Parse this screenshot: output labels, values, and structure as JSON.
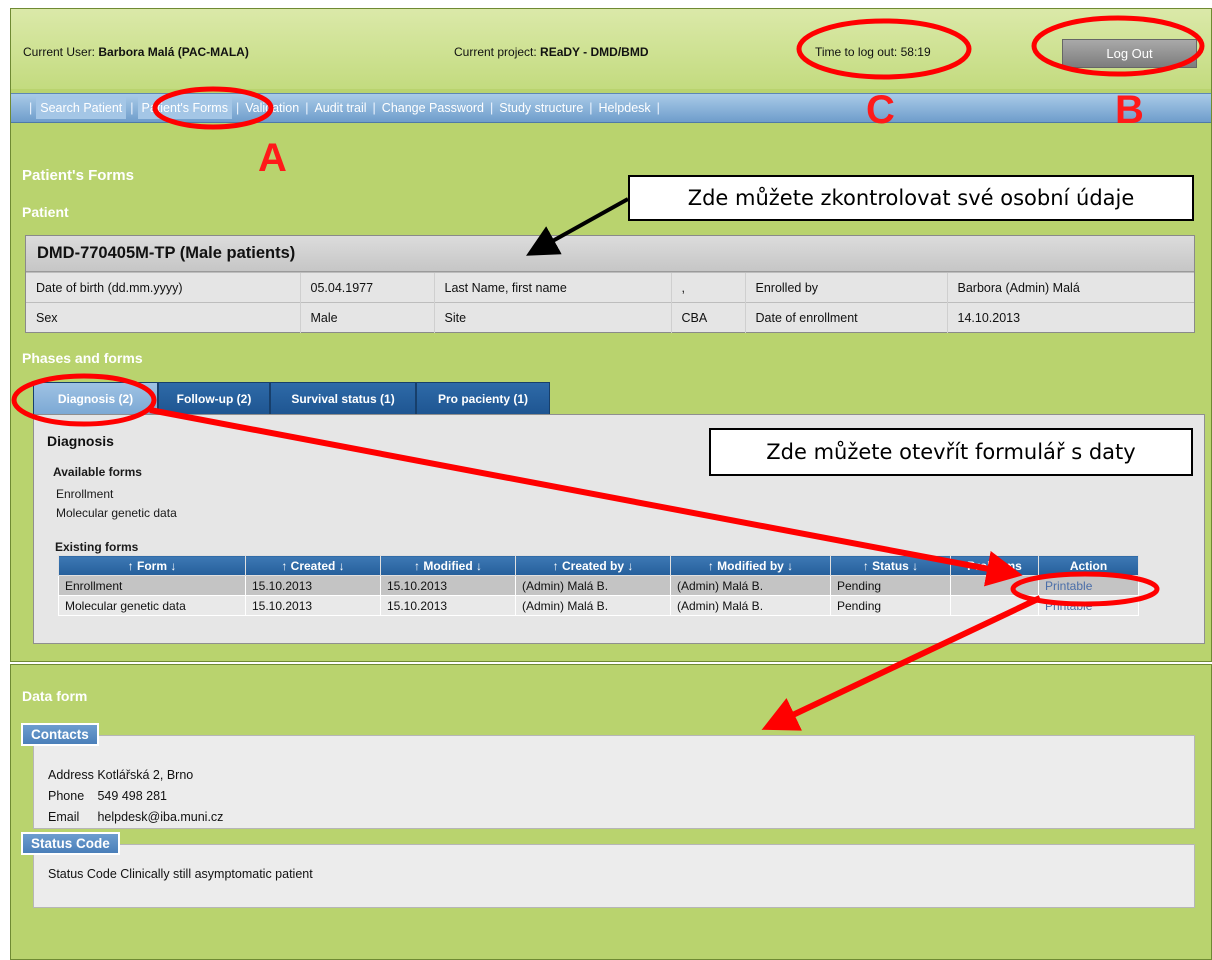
{
  "header": {
    "user_label": "Current User:",
    "user_name": "Barbora Malá (PAC-MALA)",
    "project_label": "Current project:",
    "project_name": "REaDY - DMD/BMD",
    "timer_label": "Time to log out:",
    "timer_value": "58:19",
    "logout_label": "Log Out"
  },
  "nav": {
    "items": [
      {
        "label": "Search Patient"
      },
      {
        "label": "Patient's Forms"
      },
      {
        "label": "Validation"
      },
      {
        "label": "Audit trail"
      },
      {
        "label": "Change Password"
      },
      {
        "label": "Study structure"
      },
      {
        "label": "Helpdesk"
      }
    ]
  },
  "page": {
    "title": "Patient's Forms",
    "patient_heading": "Patient",
    "phases_heading": "Phases and forms"
  },
  "patient": {
    "id": "DMD-770405M-TP (Male patients)",
    "rows": [
      [
        "Date of birth (dd.mm.yyyy)",
        "05.04.1977",
        "Last Name, first name",
        ",",
        "Enrolled by",
        "Barbora (Admin) Malá"
      ],
      [
        "Sex",
        "Male",
        "Site",
        "CBA",
        "Date of enrollment",
        "14.10.2013"
      ]
    ]
  },
  "tabs": [
    {
      "label": "Diagnosis (2)"
    },
    {
      "label": "Follow-up (2)"
    },
    {
      "label": "Survival status (1)"
    },
    {
      "label": "Pro pacienty (1)"
    }
  ],
  "diagnosis": {
    "title": "Diagnosis",
    "available_heading": "Available forms",
    "available": [
      "Enrollment",
      "Molecular genetic data"
    ],
    "existing_heading": "Existing forms",
    "columns": [
      "Form",
      "Created",
      "Modified",
      "Created by",
      "Modified by",
      "Status",
      "Problems",
      "Action"
    ],
    "rows": [
      [
        "Enrollment",
        "15.10.2013",
        "15.10.2013",
        "(Admin) Malá B.",
        "(Admin) Malá B.",
        "Pending",
        "",
        "Printable"
      ],
      [
        "Molecular genetic data",
        "15.10.2013",
        "15.10.2013",
        "(Admin) Malá B.",
        "(Admin) Malá B.",
        "Pending",
        "",
        "Printable"
      ]
    ]
  },
  "data_form": {
    "title": "Data form",
    "contacts_legend": "Contacts",
    "contacts": [
      {
        "key": "Address",
        "value": "Kotlářská 2, Brno"
      },
      {
        "key": "Phone",
        "value": "549 498 281"
      },
      {
        "key": "Email",
        "value": "helpdesk@iba.muni.cz"
      }
    ],
    "status_legend": "Status Code",
    "status_line": "Status Code Clinically still asymptomatic patient"
  },
  "annotations": {
    "callout_personal": "Zde můžete zkontrolovat své osobní údaje",
    "callout_form": "Zde můžete otevřít formulář s daty",
    "letter_a": "A",
    "letter_b": "B",
    "letter_c": "C",
    "marker_color": "#ff0000"
  }
}
